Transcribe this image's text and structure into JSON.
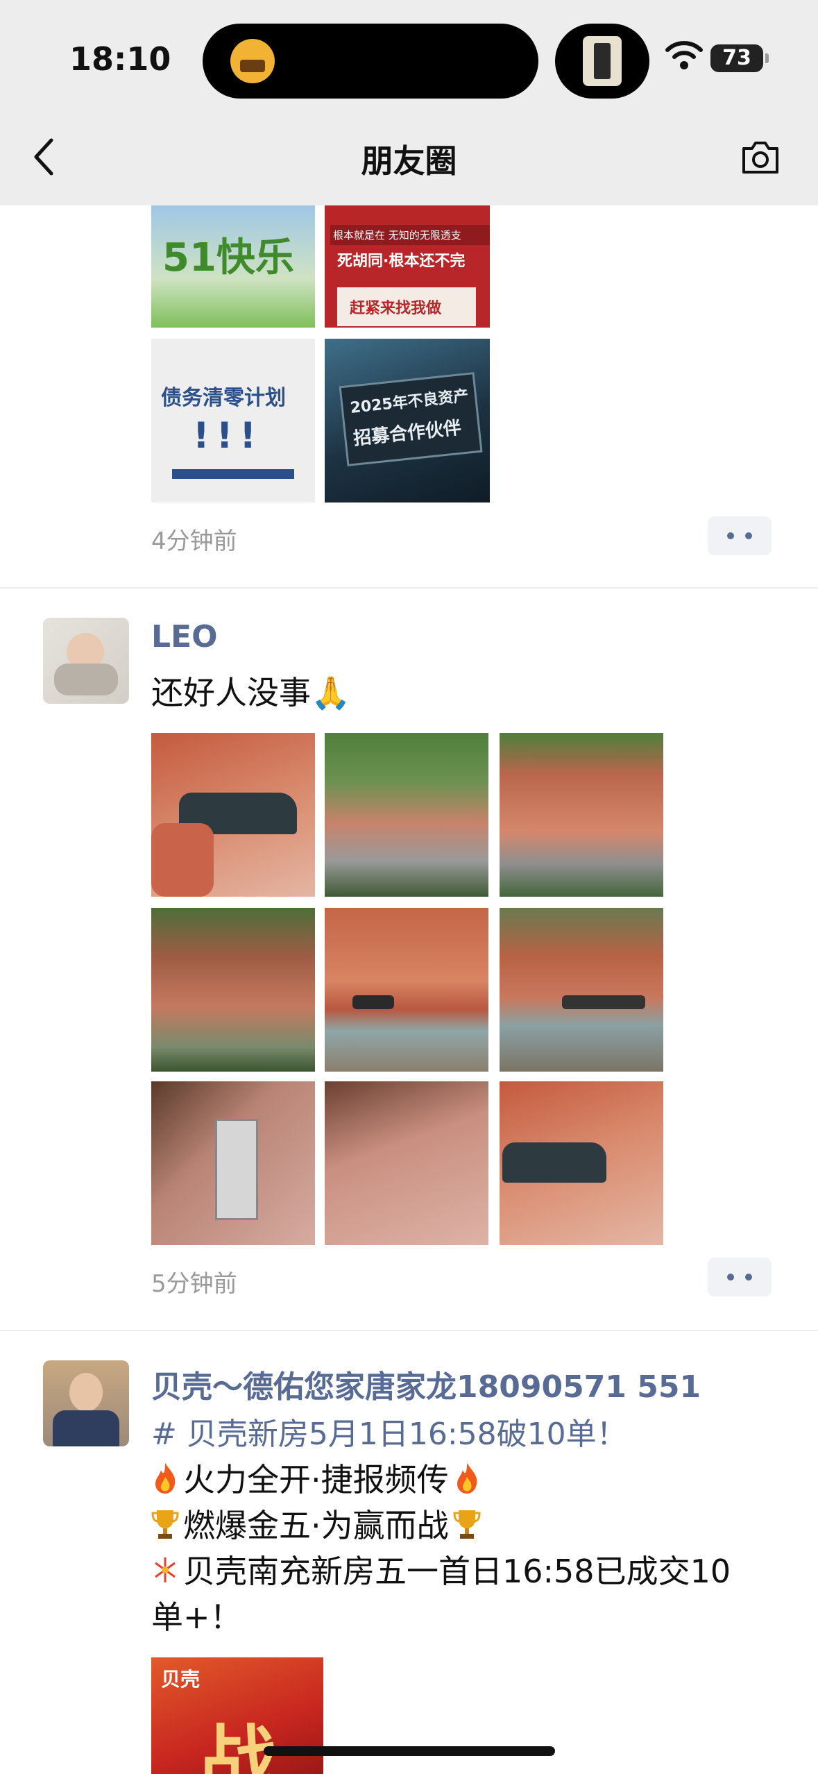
{
  "status_bar": {
    "time": "18:10",
    "battery": "73"
  },
  "nav": {
    "title": "朋友圈"
  },
  "posts": [
    {
      "image_texts": [
        "51快乐",
        "根本就是在 无知的无限透支",
        "死胡同·根本还不完",
        "赶紧来找我做",
        "债务清零计划",
        "!!!",
        "2025年不良资产",
        "招募合作伙伴"
      ],
      "time": "4分钟前"
    },
    {
      "name": "LEO",
      "text": "还好人没事🙏",
      "time": "5分钟前"
    },
    {
      "name": "贝壳～德佑您家唐家龙18090571 551",
      "hashtag": "# 贝壳新房5月1日16:58破10单！",
      "lines": [
        "火力全开·捷报频传",
        "燃爆金五·为赢而战",
        "贝壳南充新房五一首日16:58已成交10",
        "单+！"
      ],
      "image_texts": [
        "贝壳",
        "战"
      ]
    }
  ]
}
